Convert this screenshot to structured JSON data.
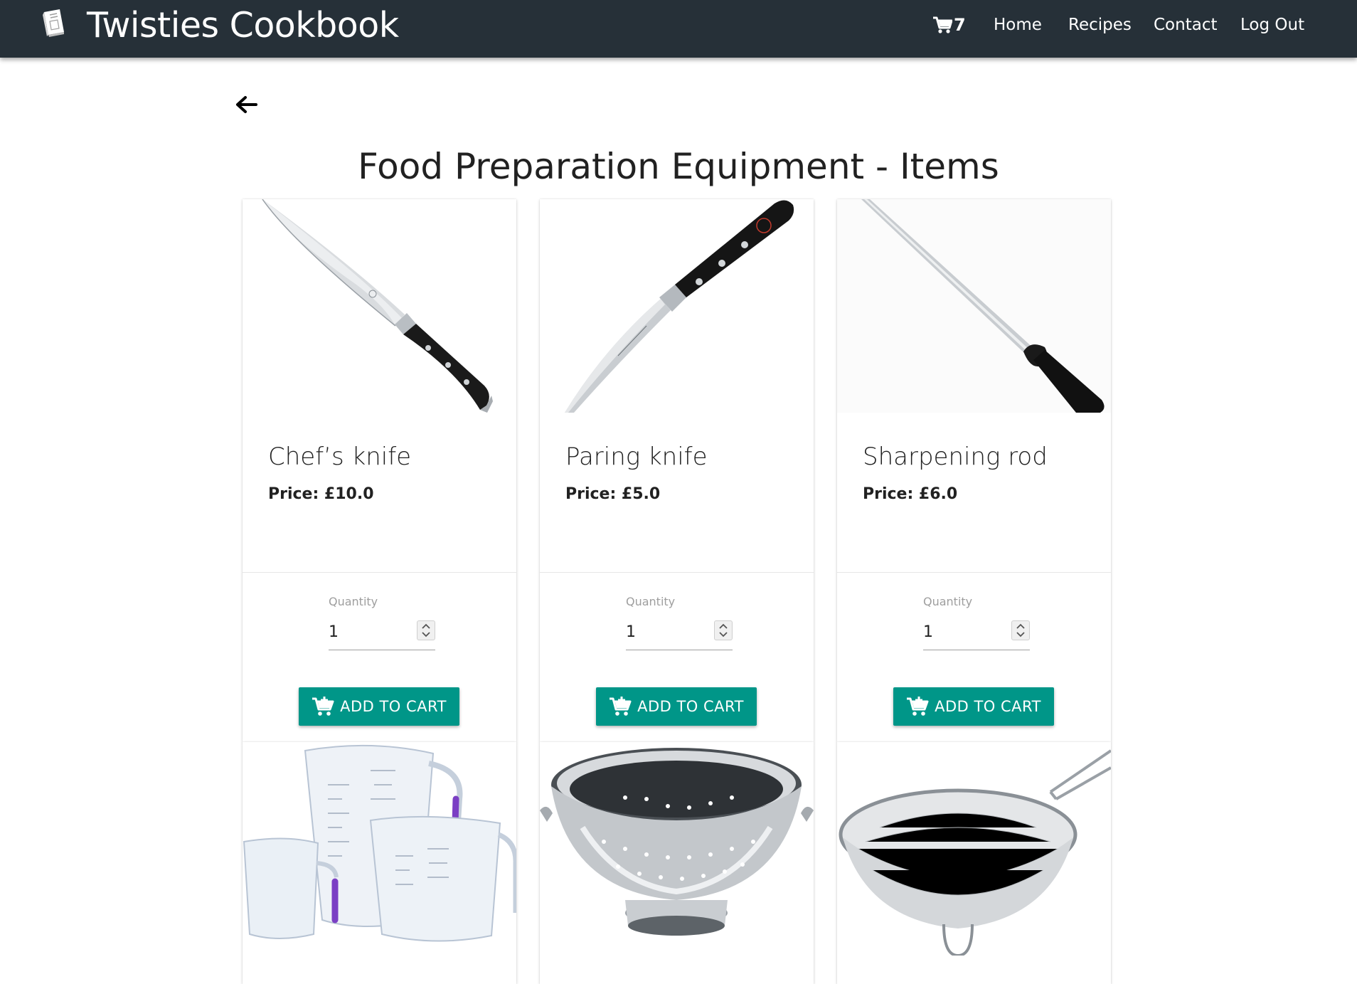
{
  "navbar": {
    "title": "Twisties Cookbook",
    "brand_icon": "book-icon",
    "cart_count": "7",
    "links": [
      "Home",
      "Recipes",
      "Contact",
      "Log Out"
    ]
  },
  "page": {
    "back_icon": "arrow-left-icon",
    "title": "Food Preparation Equipment - Items"
  },
  "products": [
    {
      "name": "Chef’s knife",
      "price": "Price: £10.0",
      "qty_label": "Quantity",
      "qty_value": "1",
      "button_label": "ADD TO CART",
      "image_icon": "chefs-knife-image"
    },
    {
      "name": "Paring knife",
      "price": "Price: £5.0",
      "qty_label": "Quantity",
      "qty_value": "1",
      "button_label": "ADD TO CART",
      "image_icon": "paring-knife-image"
    },
    {
      "name": "Sharpening rod",
      "price": "Price: £6.0",
      "qty_label": "Quantity",
      "qty_value": "1",
      "button_label": "ADD TO CART",
      "image_icon": "sharpening-rod-image"
    },
    {
      "image_icon": "measuring-cups-image"
    },
    {
      "image_icon": "colander-image"
    },
    {
      "image_icon": "sieve-image"
    }
  ],
  "colors": {
    "navbar": "#263038",
    "button": "#009688",
    "text": "#212121",
    "muted": "#9e9e9e"
  }
}
